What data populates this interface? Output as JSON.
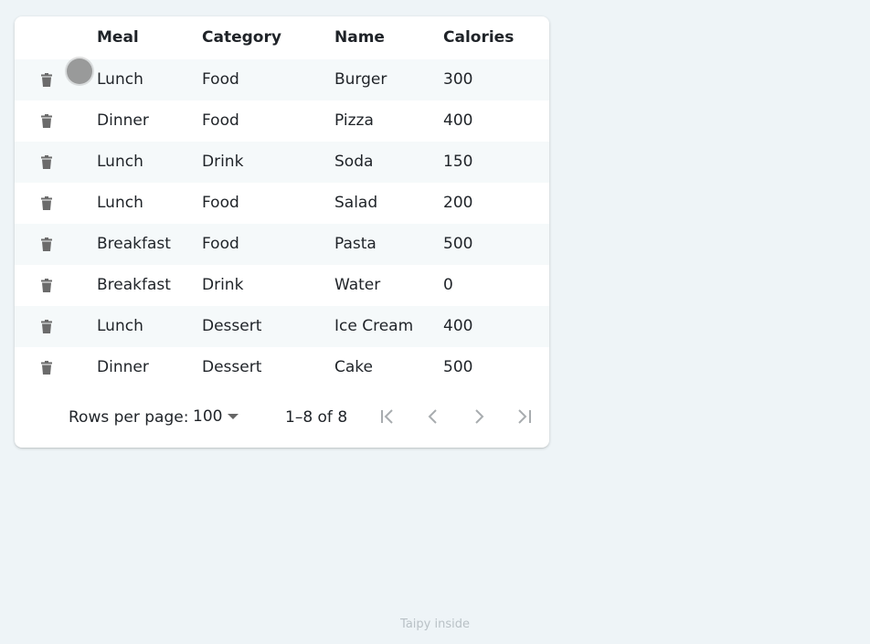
{
  "table": {
    "columns": {
      "meal": "Meal",
      "category": "Category",
      "name": "Name",
      "calories": "Calories"
    },
    "rows": [
      {
        "meal": "Lunch",
        "category": "Food",
        "name": "Burger",
        "calories": "300"
      },
      {
        "meal": "Dinner",
        "category": "Food",
        "name": "Pizza",
        "calories": "400"
      },
      {
        "meal": "Lunch",
        "category": "Drink",
        "name": "Soda",
        "calories": "150"
      },
      {
        "meal": "Lunch",
        "category": "Food",
        "name": "Salad",
        "calories": "200"
      },
      {
        "meal": "Breakfast",
        "category": "Food",
        "name": "Pasta",
        "calories": "500"
      },
      {
        "meal": "Breakfast",
        "category": "Drink",
        "name": "Water",
        "calories": "0"
      },
      {
        "meal": "Lunch",
        "category": "Dessert",
        "name": "Ice Cream",
        "calories": "400"
      },
      {
        "meal": "Dinner",
        "category": "Dessert",
        "name": "Cake",
        "calories": "500"
      }
    ],
    "row_action_icon": "trash-icon"
  },
  "pagination": {
    "rows_per_page_label": "Rows per page:",
    "rows_per_page_value": "100",
    "range_label": "1–8 of 8",
    "icons": [
      "first-page-icon",
      "previous-page-icon",
      "next-page-icon",
      "last-page-icon"
    ]
  },
  "footer": {
    "brand_text": "Taipy inside"
  },
  "colors": {
    "background": "#eef4f7",
    "stripe": "#f5f9fa",
    "icon": "#6b6b6b",
    "disabled_icon": "#a8acaf"
  }
}
